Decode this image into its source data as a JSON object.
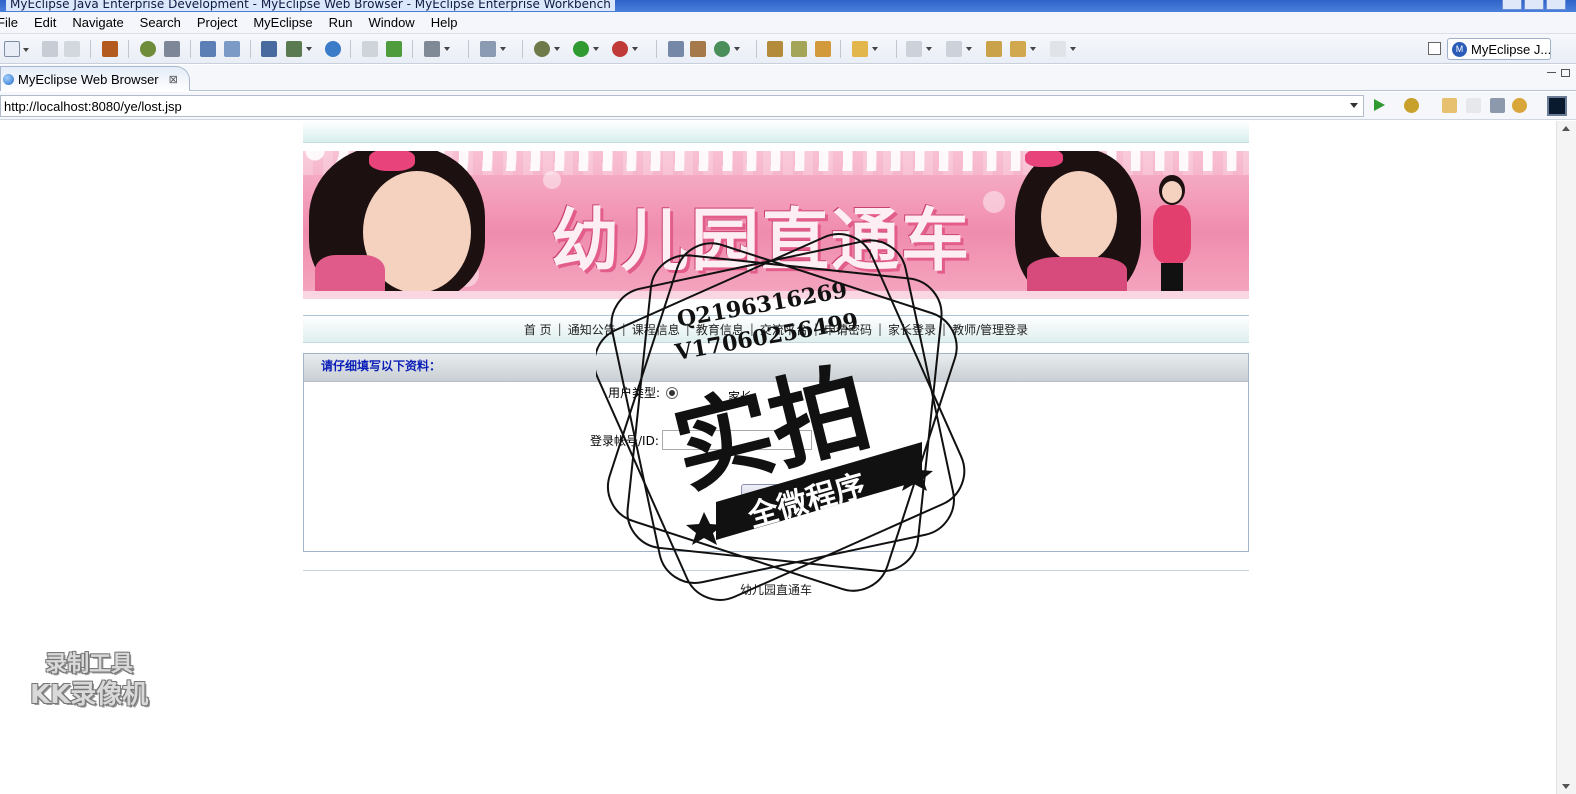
{
  "window": {
    "title": "MyEclipse Java Enterprise Development - MyEclipse Web Browser - MyEclipse Enterprise Workbench"
  },
  "menu": {
    "items": [
      "File",
      "Edit",
      "Navigate",
      "Search",
      "Project",
      "MyEclipse",
      "Run",
      "Window",
      "Help"
    ]
  },
  "toolbar": {
    "perspective_label": "MyEclipse J...",
    "perspective_icon": "myeclipse-perspective-icon"
  },
  "editor": {
    "tab_label": "MyEclipse Web Browser",
    "tab_close": "⊠"
  },
  "browser": {
    "url": "http://localhost:8080/ye/lost.jsp"
  },
  "page": {
    "banner_title": "幼儿园直通车",
    "nav": [
      "首 页",
      "通知公告",
      "课程信息",
      "教育信息",
      "交流平台",
      "申请密码",
      "家长登录",
      "教师/管理登录"
    ],
    "nav_separator": "|",
    "form": {
      "header": "请仔细填写以下资料：",
      "user_type_label": "用户类型:",
      "user_type_option": "家长",
      "account_label": "登录帐号/ID:",
      "submit_label": "提交"
    },
    "footer": "幼儿园直通车"
  },
  "overlay": {
    "stamp_line1": "Q2196316269",
    "stamp_line2": "V17060256499",
    "stamp_main": "实拍",
    "stamp_banner": "全微程序",
    "recorder_line1": "录制工具",
    "recorder_line2": "KK录像机"
  },
  "colors": {
    "form_header_text": "#0b1fb8",
    "banner_pink": "#f08cad",
    "run_green": "#2f9a2f"
  }
}
